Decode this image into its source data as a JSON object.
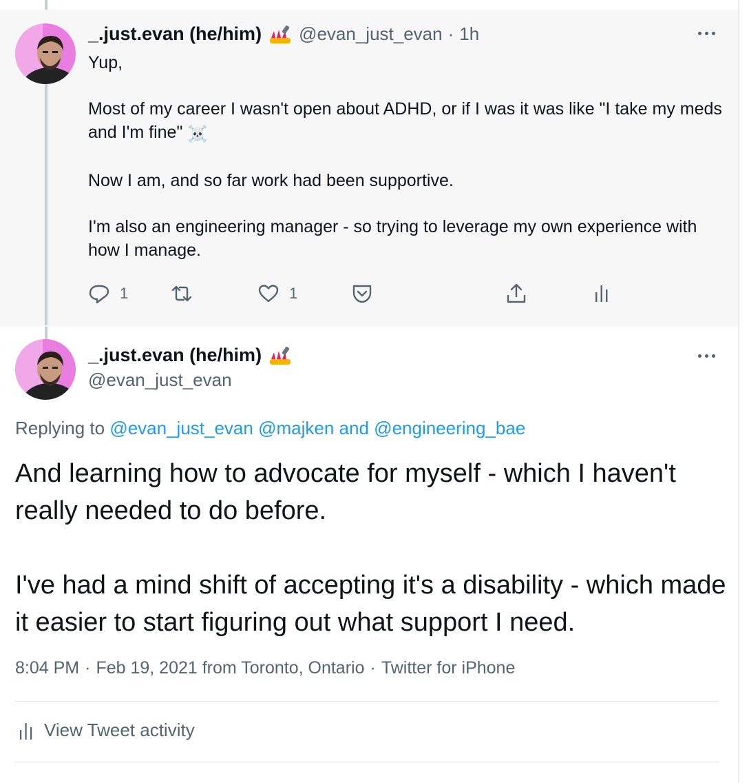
{
  "parent_tweet": {
    "author_name": "_.just.evan (he/him)",
    "author_emoji": "nail-polish-emoji",
    "handle": "@evan_just_evan",
    "separator": "·",
    "time": "1h",
    "paragraphs": [
      "Yup,",
      "Most of my career I wasn't open about ADHD, or if I was it was like \"I take my meds and I'm fine\"",
      "Now I am, and so far work had been supportive.",
      "I'm also an engineering manager - so trying to leverage my own experience with how I manage."
    ],
    "skull_emoji": "☠️",
    "actions": {
      "reply_count": "1",
      "retweet_count": "",
      "like_count": "1"
    }
  },
  "main_tweet": {
    "author_name": "_.just.evan (he/him)",
    "handle": "@evan_just_evan",
    "replying_prefix": "Replying to",
    "reply_mention_1": "@evan_just_evan",
    "reply_mention_2": "@majken",
    "reply_and": "and",
    "reply_mention_3": "@engineering_bae",
    "paragraphs": [
      "And learning how to advocate for myself - which I haven't really needed to do before.",
      "I've had a mind shift of accepting it's a disability - which made it easier to start figuring out what support I need."
    ],
    "time": "8:04 PM",
    "separator": "·",
    "date": "Feb 19, 2021",
    "location": "from Toronto, Ontario",
    "source": "Twitter for iPhone",
    "activity_label": "View Tweet activity"
  },
  "colors": {
    "link": "#1d9bf0",
    "muted": "#536471",
    "parent_bg": "#f7f7f7"
  }
}
